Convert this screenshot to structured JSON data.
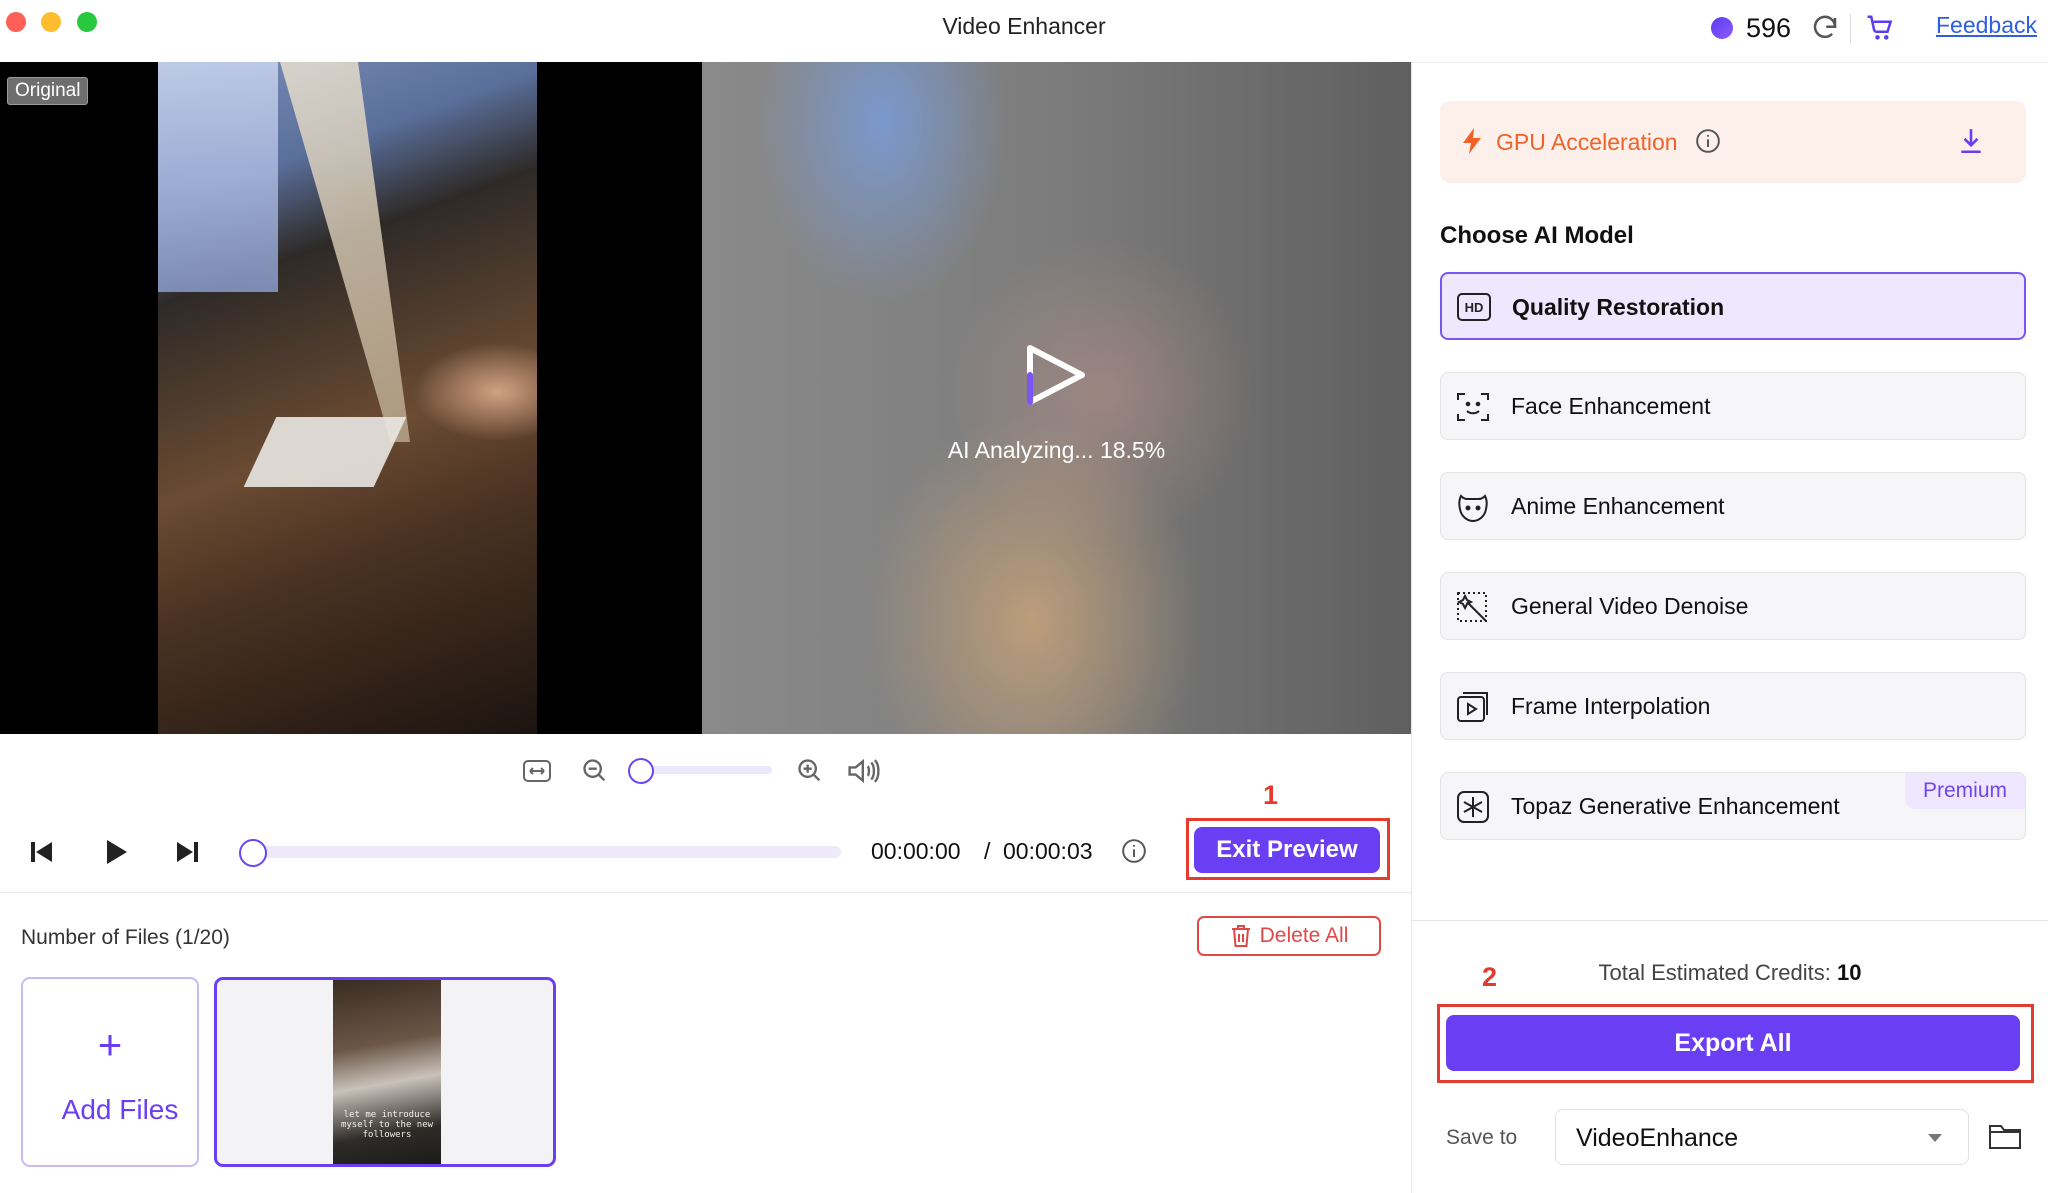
{
  "window": {
    "title": "Video Enhancer"
  },
  "header": {
    "credits": "596",
    "feedback_label": "Feedback"
  },
  "preview": {
    "original_badge": "Original",
    "analyzing_text": "AI Analyzing... 18.5%",
    "analyzing_progress": 18.5,
    "thumbnail_caption": "let me introduce myself to the new followers"
  },
  "playback": {
    "current_time": "00:00:00",
    "separator": "/",
    "total_time": "00:00:03",
    "exit_preview_label": "Exit Preview",
    "timeline_position": 0,
    "zoom_level": 0
  },
  "files": {
    "count_label": "Number of Files (1/20)",
    "delete_all_label": "Delete All",
    "add_plus": "+",
    "add_files_label": "Add Files"
  },
  "panel": {
    "gpu_label": "GPU Acceleration",
    "choose_model_label": "Choose AI Model",
    "models": [
      {
        "label": "Quality Restoration",
        "icon": "hd-icon",
        "selected": true
      },
      {
        "label": "Face Enhancement",
        "icon": "face-scan-icon",
        "selected": false
      },
      {
        "label": "Anime Enhancement",
        "icon": "anime-face-icon",
        "selected": false
      },
      {
        "label": "General Video Denoise",
        "icon": "denoise-wand-icon",
        "selected": false
      },
      {
        "label": "Frame Interpolation",
        "icon": "frame-play-icon",
        "selected": false
      },
      {
        "label": "Topaz Generative Enhancement",
        "icon": "sparkle-icon",
        "selected": false,
        "badge": "Premium"
      }
    ],
    "credits_label": "Total Estimated Credits:",
    "credits_value": "10",
    "export_all_label": "Export All",
    "save_to_label": "Save to",
    "save_to_value": "VideoEnhance"
  },
  "annotations": {
    "step_1": "1",
    "step_2": "2"
  },
  "colors": {
    "accent": "#6a3ef2",
    "annotation": "#e33b2e",
    "gpu": "#f0622a",
    "danger": "#e04848"
  }
}
